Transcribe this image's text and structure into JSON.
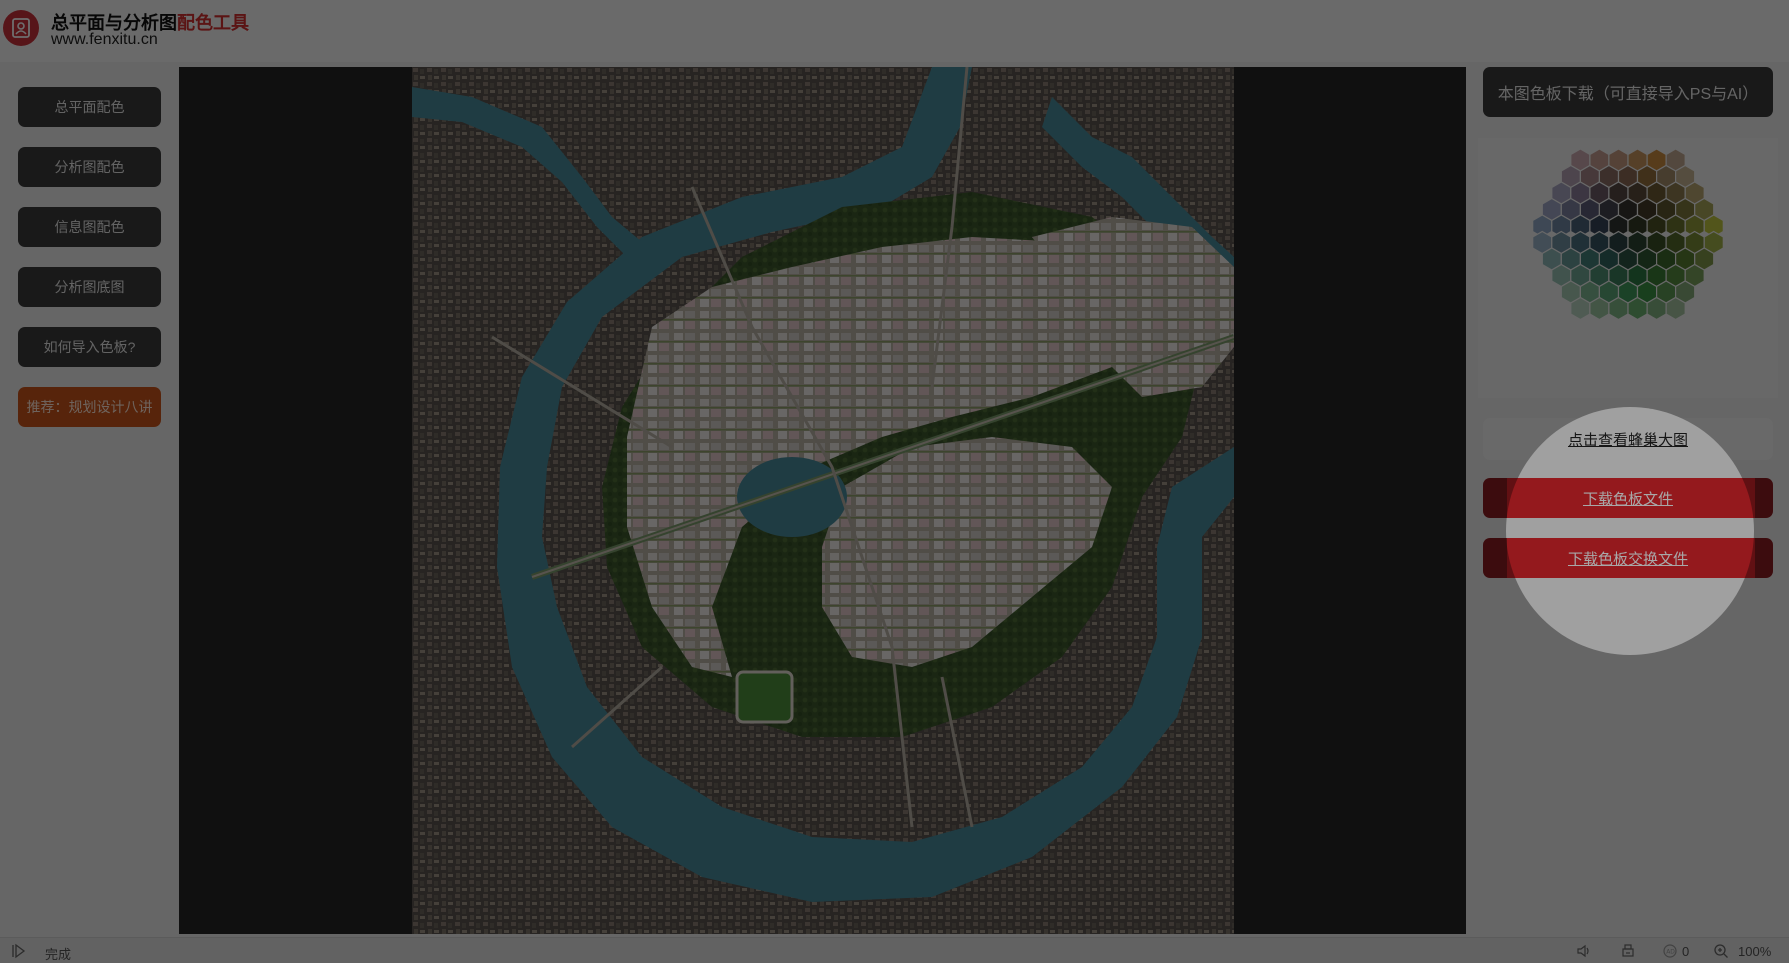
{
  "header": {
    "title_main": "总平面与分析图",
    "title_accent": "配色工具",
    "url": "www.fenxitu.cn",
    "accent_color": "#d23030"
  },
  "nav": {
    "items": [
      {
        "label": "总平面配色"
      },
      {
        "label": "分析图配色"
      },
      {
        "label": "信息图配色"
      },
      {
        "label": "分析图底图"
      },
      {
        "label": "如何导入色板?"
      }
    ],
    "recommend": {
      "label": "推荐：规划设计八讲"
    }
  },
  "panel": {
    "header": "本图色板下载（可直接导入PS与AI）",
    "view_honeycomb": "点击查看蜂巢大图",
    "download_palette": "下载色板文件",
    "download_swatch_exchange": "下载色板交换文件",
    "button_color": "#e1262d"
  },
  "palette": {
    "swatches": [
      "#c9a8ad",
      "#c59d91",
      "#c49a80",
      "#c7935f",
      "#c88b3f",
      "#c1a890",
      "#b2a0b4",
      "#a48487",
      "#8a6e64",
      "#8c6a55",
      "#94713e",
      "#a68d6b",
      "#c5b392",
      "#a8a4c1",
      "#8c7f99",
      "#6e5c68",
      "#574a45",
      "#5c4b3a",
      "#6e5b34",
      "#8d7b4f",
      "#b6a570",
      "#9fa6c6",
      "#7e82a2",
      "#5d5e79",
      "#44434f",
      "#383530",
      "#433c28",
      "#5e5730",
      "#7f7a3e",
      "#a8a45a",
      "#8fa7c4",
      "#6f88a3",
      "#4b627a",
      "#37455a",
      "#2f3533",
      "#353a26",
      "#4d5326",
      "#6c7630",
      "#929b3a",
      "#bec63f",
      "#9ab3c7",
      "#6f8fa2",
      "#4b6f80",
      "#365663",
      "#2d4446",
      "#2e4331",
      "#3c5127",
      "#56692b",
      "#798c36",
      "#a2b04a",
      "#8eb8b6",
      "#679a96",
      "#45807a",
      "#336560",
      "#2c5444",
      "#2f5a35",
      "#3d6a2c",
      "#5a7d33",
      "#80964a",
      "#96c0b4",
      "#70a793",
      "#4f8f75",
      "#3a7f5b",
      "#2e7a44",
      "#3a7d37",
      "#578a40",
      "#7aa05b",
      "#a4c8b2",
      "#7db692",
      "#5ba577",
      "#409a5b",
      "#3a9245",
      "#5f9a55",
      "#85aa78",
      "#b8d2c0",
      "#9bc5a2",
      "#80b888",
      "#6cb070",
      "#83b482",
      "#a4c2a0"
    ]
  },
  "statusbar": {
    "status": "完成",
    "zero_count": "0",
    "zoom": "100%"
  }
}
